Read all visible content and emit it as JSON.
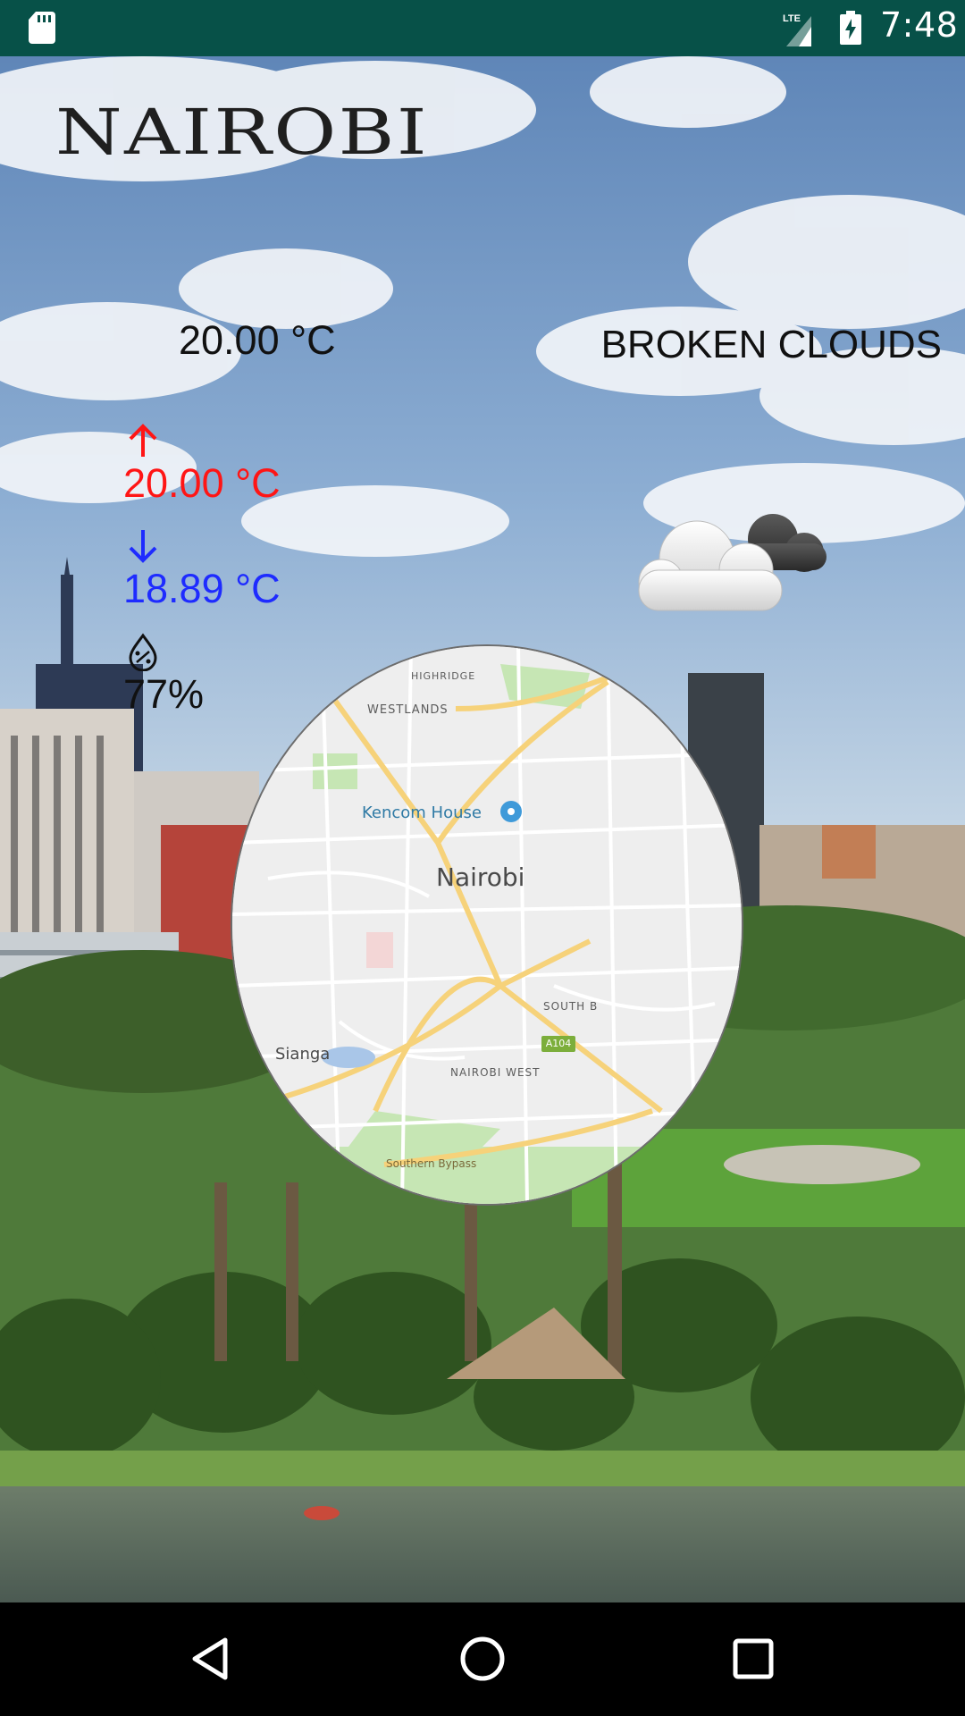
{
  "status_bar": {
    "time": "7:48",
    "network": "LTE",
    "icons": [
      "sd-card-icon",
      "lte-signal-icon",
      "battery-charging-icon"
    ]
  },
  "weather": {
    "city": "NAIROBI",
    "current_temp": "20.00 °C",
    "max_temp": "20.00 °C",
    "min_temp": "18.89 °C",
    "humidity": "77%",
    "description": "BROKEN CLOUDS",
    "icon": "broken-clouds-icon",
    "colors": {
      "max": "#ff1515",
      "min": "#1e2bff",
      "text": "#111111"
    }
  },
  "map": {
    "city_label": "Nairobi",
    "poi_label": "Kencom House",
    "district_labels": {
      "westlands": "WESTLANDS",
      "highridge": "HIGHRIDGE",
      "south_b": "SOUTH B",
      "nairobi_west": "NAIROBI WEST",
      "sianga": "Sianga",
      "southern_bypass": "Southern Bypass"
    },
    "road_badge": "A104"
  },
  "nav_bar": {
    "icons": [
      "back-icon",
      "home-icon",
      "recents-icon"
    ]
  }
}
